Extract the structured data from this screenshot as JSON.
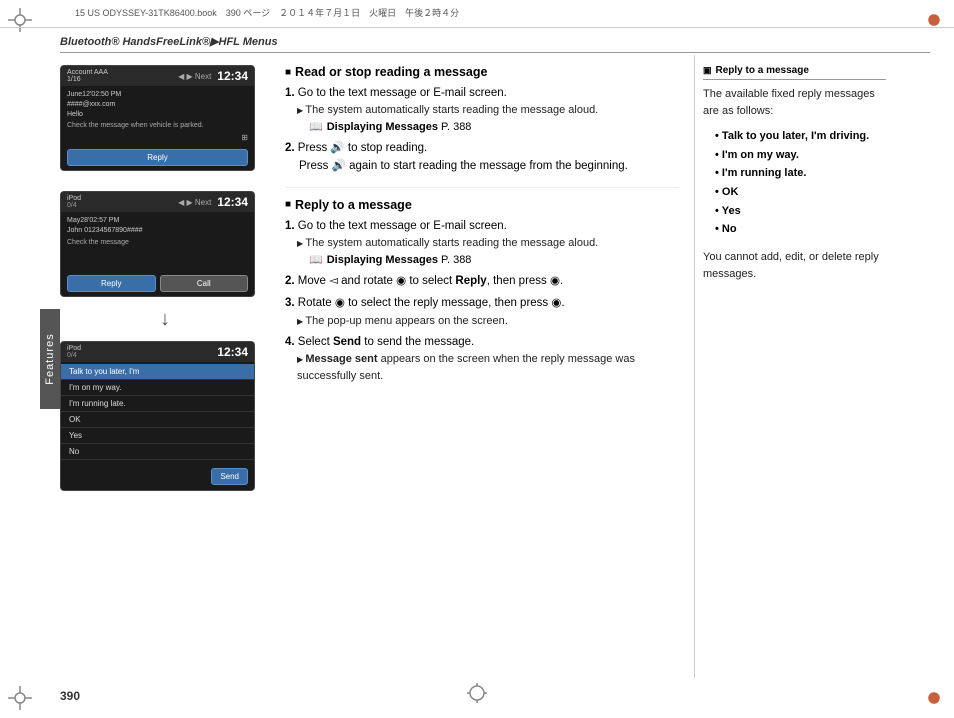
{
  "page": {
    "number": "390",
    "top_file": "15 US ODYSSEY-31TK86400.book　390 ページ　２０１４年７月１日　火曜日　午後２時４分"
  },
  "breadcrumb": {
    "text": "Bluetooth® HandsFreeLink®▶HFL Menus"
  },
  "features_label": "Features",
  "section1": {
    "heading": "Read or stop reading a message",
    "steps": [
      {
        "number": "1.",
        "text": "Go to the text message or E-mail screen.",
        "sub": "The system automatically starts reading the message aloud.",
        "ref": "Displaying Messages P. 388"
      },
      {
        "number": "2.",
        "text": "Press  to stop reading.",
        "text2": "Press  again to start reading the message from the beginning."
      }
    ]
  },
  "section2": {
    "heading": "Reply to a message",
    "steps": [
      {
        "number": "1.",
        "text": "Go to the text message or E-mail screen.",
        "sub": "The system automatically starts reading the message aloud.",
        "ref": "Displaying Messages P. 388"
      },
      {
        "number": "2.",
        "text": "Move  and rotate  to select Reply, then press ."
      },
      {
        "number": "3.",
        "text": "Rotate  to select the reply message, then press .",
        "sub": "The pop-up menu appears on the screen."
      },
      {
        "number": "4.",
        "text": "Select Send to send the message.",
        "sub": "Message sent appears on the screen when the reply message was successfully sent."
      }
    ]
  },
  "right_panel": {
    "title": "Reply to a message",
    "description": "The available fixed reply messages are as follows:",
    "replies": [
      {
        "text": "Talk to you later, I'm driving.",
        "bold": true
      },
      {
        "text": "I'm on my way.",
        "bold": true
      },
      {
        "text": "I'm running late.",
        "bold": true
      },
      {
        "text": "OK",
        "bold": true
      },
      {
        "text": "Yes",
        "bold": true
      },
      {
        "text": "No",
        "bold": true
      }
    ],
    "note": "You cannot add, edit, or delete reply messages."
  },
  "screen1": {
    "account": "Account AAA",
    "nav": "1/16",
    "time": "12:34",
    "date": "June12'02:50 PM",
    "contact": "####@xxx.com",
    "subject": "Hello",
    "message": "Check the message when vehicle is parked.",
    "button": "Reply"
  },
  "screen2": {
    "source": "iPod",
    "track": "0/4",
    "time": "12:34",
    "date": "May28'02:57 PM",
    "contact": "John 01234567890####",
    "message": "Check the message",
    "btn1": "Reply",
    "btn2": "Call"
  },
  "screen3": {
    "source": "iPod",
    "track": "0/4",
    "time": "12:34",
    "items": [
      "Talk to you later, I'm",
      "I'm on my way.",
      "I'm running late.",
      "OK",
      "Yes",
      "No"
    ],
    "selected_index": 0,
    "send_btn": "Send"
  }
}
